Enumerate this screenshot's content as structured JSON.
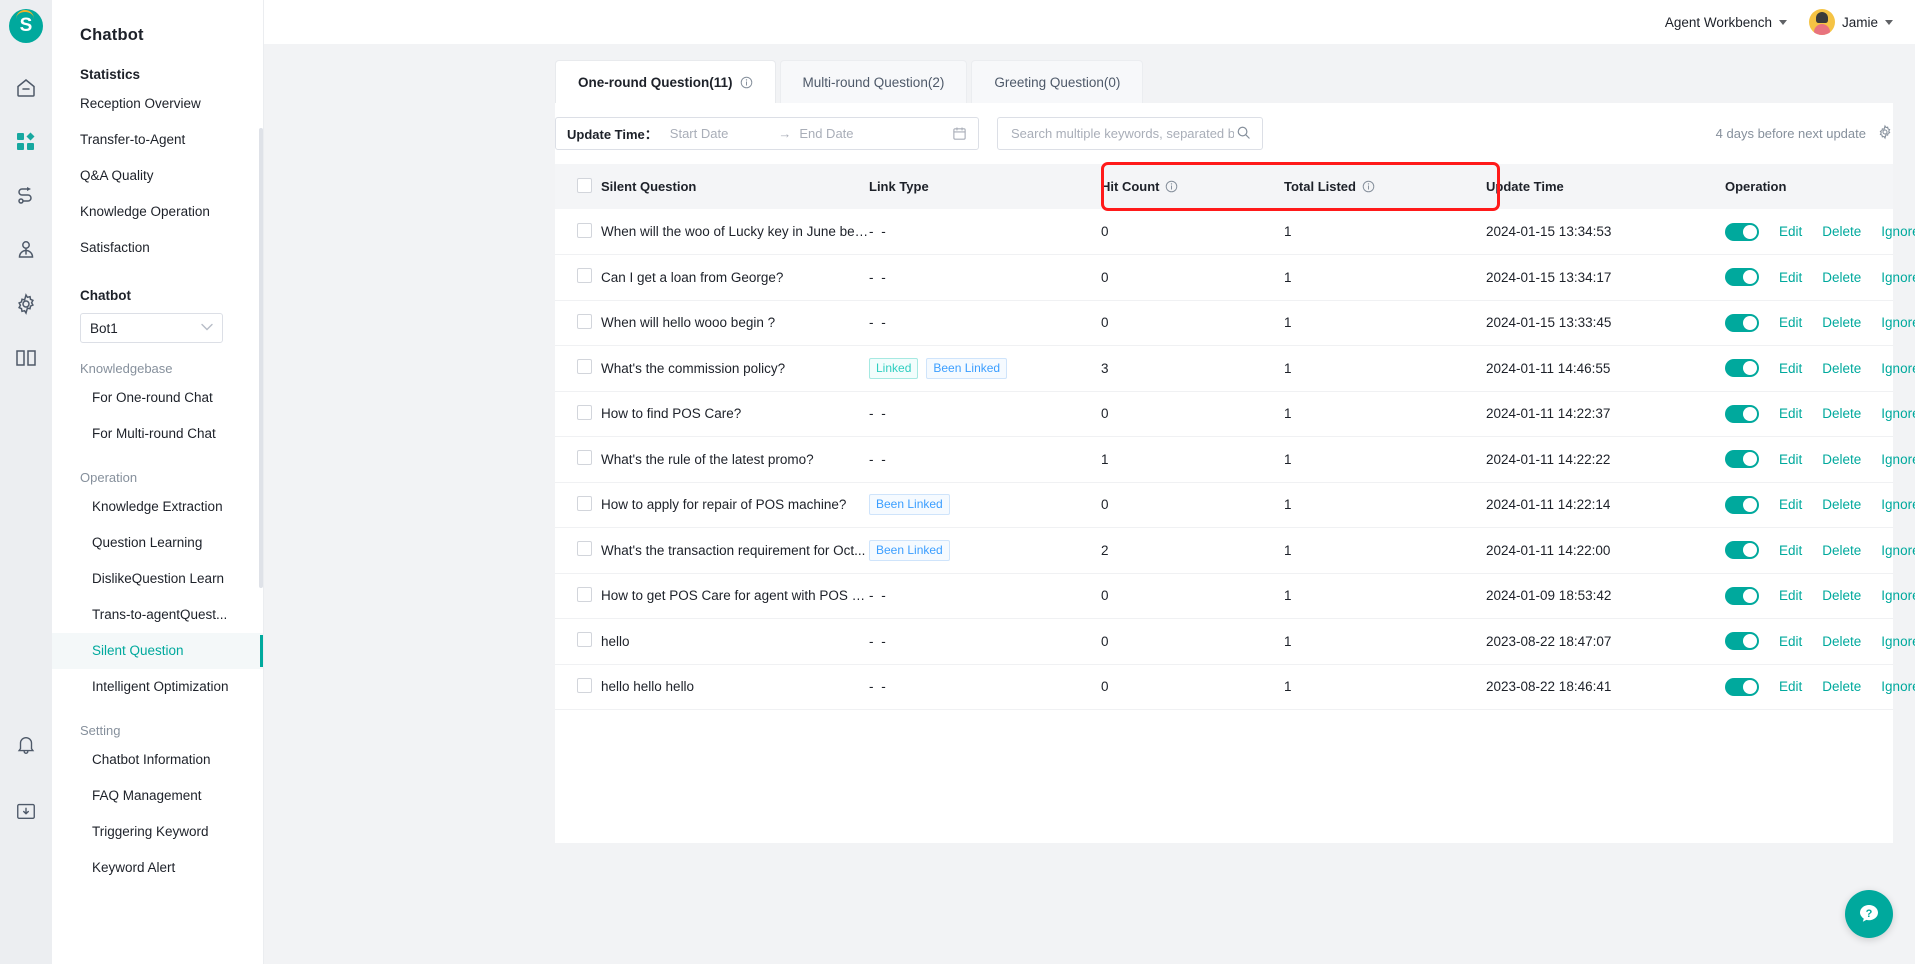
{
  "brand": {
    "logo_letter": "S",
    "accent": "#00a99d",
    "annotation_color": "#ff1a1a"
  },
  "topbar": {
    "workbench_label": "Agent Workbench",
    "user_name": "Jamie"
  },
  "sidebar": {
    "title": "Chatbot",
    "groups": [
      {
        "label": "Statistics",
        "bold": true,
        "items": [
          {
            "label": "Reception Overview"
          },
          {
            "label": "Transfer-to-Agent"
          },
          {
            "label": "Q&A Quality"
          },
          {
            "label": "Knowledge Operation"
          },
          {
            "label": "Satisfaction"
          }
        ]
      }
    ],
    "chatbot_group_label": "Chatbot",
    "bot_select_value": "Bot1",
    "knowledgebase_label": "Knowledgebase",
    "knowledgebase_items": [
      {
        "label": "For One-round Chat"
      },
      {
        "label": "For Multi-round Chat"
      }
    ],
    "operation_label": "Operation",
    "operation_items": [
      {
        "label": "Knowledge Extraction",
        "active": false
      },
      {
        "label": "Question Learning",
        "active": false
      },
      {
        "label": "DislikeQuestion Learn",
        "active": false
      },
      {
        "label": "Trans-to-agentQuest...",
        "active": false
      },
      {
        "label": "Silent Question",
        "active": true
      },
      {
        "label": "Intelligent Optimization",
        "active": false
      }
    ],
    "setting_label": "Setting",
    "setting_items": [
      {
        "label": "Chatbot Information"
      },
      {
        "label": "FAQ Management"
      },
      {
        "label": "Triggering Keyword"
      },
      {
        "label": "Keyword Alert"
      }
    ]
  },
  "tabs": [
    {
      "label": "One-round Question(11)",
      "active": true,
      "has_info": true
    },
    {
      "label": "Multi-round Question(2)",
      "active": false,
      "has_info": false
    },
    {
      "label": "Greeting Question(0)",
      "active": false,
      "has_info": false
    }
  ],
  "filters": {
    "update_time_label": "Update Time：",
    "start_date_placeholder": "Start Date",
    "range_arrow": "→",
    "end_date_placeholder": "End Date",
    "search_placeholder": "Search multiple keywords, separated by ;",
    "search_value": "",
    "next_update_text": "4 days before next update"
  },
  "table": {
    "columns": [
      {
        "key": "checkbox",
        "label": ""
      },
      {
        "key": "question",
        "label": "Silent Question",
        "info": false
      },
      {
        "key": "link_type",
        "label": "Link Type",
        "info": false
      },
      {
        "key": "hit_count",
        "label": "Hit Count",
        "info": true,
        "highlighted": true
      },
      {
        "key": "total_listed",
        "label": "Total Listed",
        "info": true,
        "highlighted": true
      },
      {
        "key": "update_time",
        "label": "Update Time",
        "info": false
      },
      {
        "key": "operation",
        "label": "Operation",
        "info": false
      }
    ],
    "rows": [
      {
        "question": "When will the woo of Lucky key in June be ...",
        "tags": [],
        "hit_count": "0",
        "total_listed": "1",
        "update_time": "2024-01-15 13:34:53",
        "enabled": true
      },
      {
        "question": "Can I get a loan from George?",
        "tags": [],
        "hit_count": "0",
        "total_listed": "1",
        "update_time": "2024-01-15 13:34:17",
        "enabled": true
      },
      {
        "question": "When will hello wooo begin ?",
        "tags": [],
        "hit_count": "0",
        "total_listed": "1",
        "update_time": "2024-01-15 13:33:45",
        "enabled": true
      },
      {
        "question": "What's the commission policy?",
        "tags": [
          {
            "label": "Linked",
            "style": "linked"
          },
          {
            "label": "Been Linked",
            "style": "been"
          }
        ],
        "hit_count": "3",
        "total_listed": "1",
        "update_time": "2024-01-11 14:46:55",
        "enabled": true
      },
      {
        "question": "How to find POS Care?",
        "tags": [],
        "hit_count": "0",
        "total_listed": "1",
        "update_time": "2024-01-11 14:22:37",
        "enabled": true
      },
      {
        "question": "What's the rule of the latest promo?",
        "tags": [],
        "hit_count": "1",
        "total_listed": "1",
        "update_time": "2024-01-11 14:22:22",
        "enabled": true
      },
      {
        "question": "How to apply for repair of POS machine?",
        "tags": [
          {
            "label": "Been Linked",
            "style": "been"
          }
        ],
        "hit_count": "0",
        "total_listed": "1",
        "update_time": "2024-01-11 14:22:14",
        "enabled": true
      },
      {
        "question": "What's the transaction requirement for Oct...",
        "tags": [
          {
            "label": "Been Linked",
            "style": "been"
          }
        ],
        "hit_count": "2",
        "total_listed": "1",
        "update_time": "2024-01-11 14:22:00",
        "enabled": true
      },
      {
        "question": "How to get POS Care for agent with POS al...",
        "tags": [],
        "hit_count": "0",
        "total_listed": "1",
        "update_time": "2024-01-09 18:53:42",
        "enabled": true
      },
      {
        "question": "hello",
        "tags": [],
        "hit_count": "0",
        "total_listed": "1",
        "update_time": "2023-08-22 18:47:07",
        "enabled": true
      },
      {
        "question": "hello hello hello",
        "tags": [],
        "hit_count": "0",
        "total_listed": "1",
        "update_time": "2023-08-22 18:46:41",
        "enabled": true
      }
    ],
    "empty_dash": "- -",
    "actions": {
      "edit": "Edit",
      "delete": "Delete",
      "ignore": "Ignore"
    }
  },
  "help_button": {
    "icon": "question-mark-chat-icon"
  }
}
